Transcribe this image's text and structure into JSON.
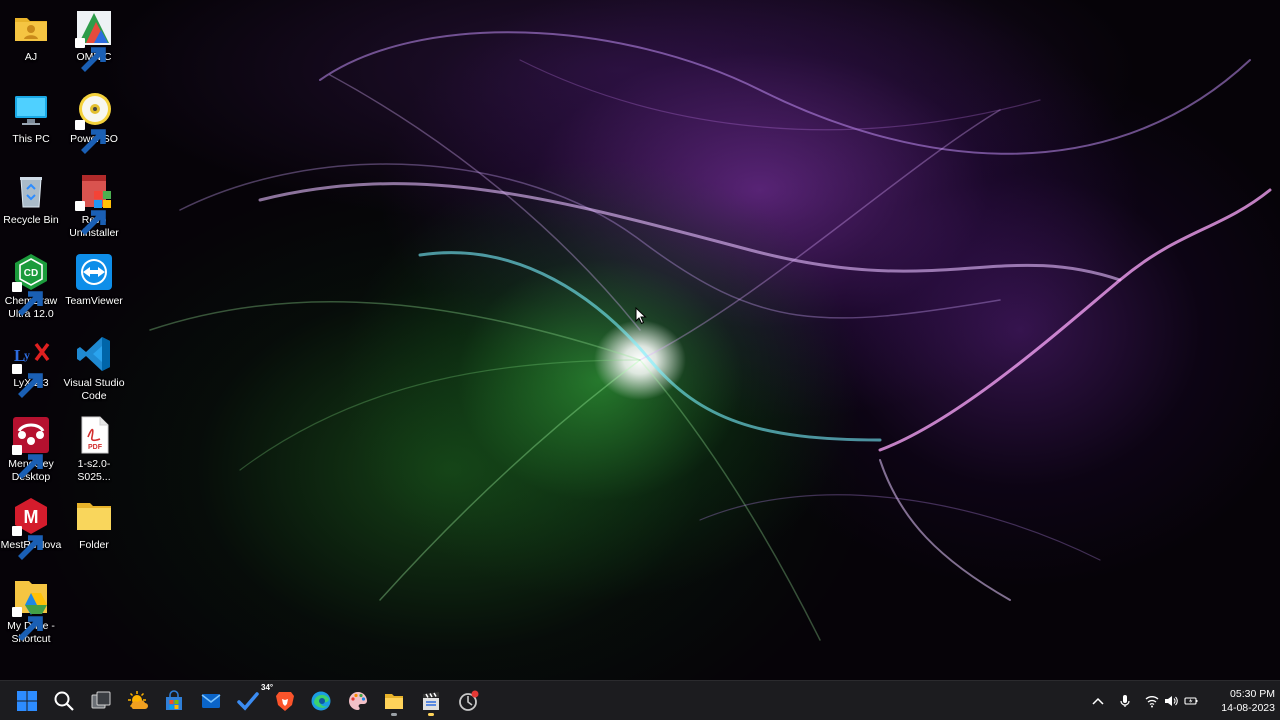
{
  "desktop": {
    "icons": [
      {
        "label": "AJ"
      },
      {
        "label": "OMNIC"
      },
      {
        "label": "This PC"
      },
      {
        "label": "PowerISO"
      },
      {
        "label": "Recycle Bin"
      },
      {
        "label": "Revo Uninstaller"
      },
      {
        "label": "ChemDraw Ultra 12.0"
      },
      {
        "label": "TeamViewer"
      },
      {
        "label": "LyX 2.3"
      },
      {
        "label": "Visual Studio Code"
      },
      {
        "label": "Mendeley Desktop"
      },
      {
        "label": "1-s2.0-S025..."
      },
      {
        "label": "MestReNova"
      },
      {
        "label": "Folder"
      },
      {
        "label": "My Drive - Shortcut"
      }
    ],
    "pdf_badge": "PDF"
  },
  "taskbar": {
    "weather_temp": "34°",
    "clock_time": "05:30 PM",
    "clock_date": "14-08-2023"
  },
  "colors": {
    "taskbar_bg": "#1c1c1f",
    "windows_blue": "#2d8cff",
    "folder_yellow": "#f5c542"
  }
}
